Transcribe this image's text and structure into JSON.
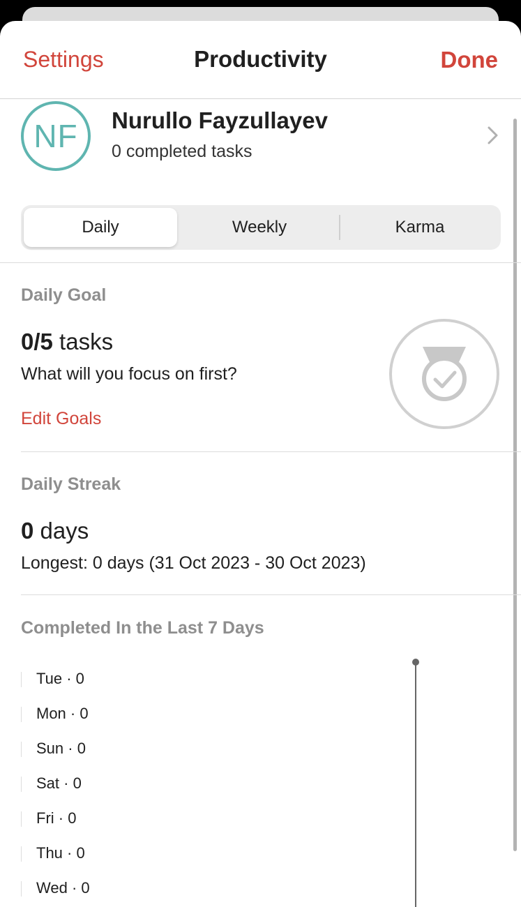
{
  "nav": {
    "left_label": "Settings",
    "title": "Productivity",
    "right_label": "Done"
  },
  "profile": {
    "initials": "NF",
    "name": "Nurullo Fayzullayev",
    "subtitle": "0 completed tasks"
  },
  "tabs": [
    {
      "label": "Daily",
      "active": true
    },
    {
      "label": "Weekly",
      "active": false
    },
    {
      "label": "Karma",
      "active": false
    }
  ],
  "daily_goal": {
    "section_title": "Daily Goal",
    "count": "0/5",
    "unit": " tasks",
    "prompt": "What will you focus on first?",
    "edit_label": "Edit Goals"
  },
  "daily_streak": {
    "section_title": "Daily Streak",
    "count": "0",
    "unit": " days",
    "longest": "Longest: 0 days (31 Oct 2023 - 30 Oct 2023)"
  },
  "last7": {
    "section_title": "Completed In the Last 7 Days",
    "days": [
      {
        "label": "Tue · 0",
        "value": 0
      },
      {
        "label": "Mon · 0",
        "value": 0
      },
      {
        "label": "Sun · 0",
        "value": 0
      },
      {
        "label": "Sat · 0",
        "value": 0
      },
      {
        "label": "Fri · 0",
        "value": 0
      },
      {
        "label": "Thu · 0",
        "value": 0
      },
      {
        "label": "Wed · 0",
        "value": 0
      }
    ]
  },
  "colors": {
    "accent": "#d1453b",
    "avatar": "#5fb5b0",
    "muted": "#8e8e8e"
  }
}
